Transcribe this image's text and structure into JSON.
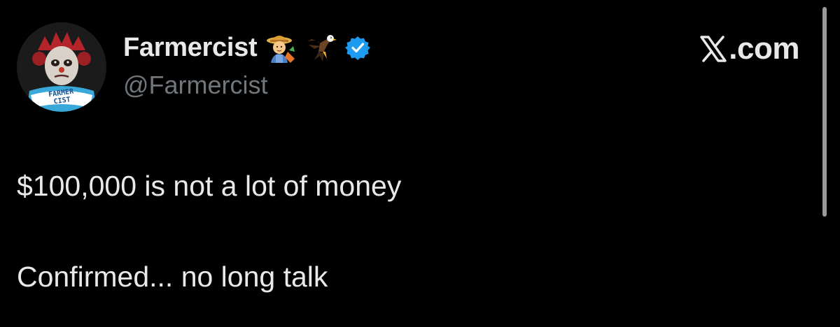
{
  "author": {
    "display_name": "Farmercist",
    "handle": "@Farmercist",
    "avatar_text_line1": "FARMER",
    "avatar_text_line2": "CIST",
    "name_emojis": [
      "farmer-emoji",
      "eagle-emoji"
    ],
    "verified": true,
    "verified_color": "#1d9bf0"
  },
  "brand": {
    "label": ".com",
    "icon": "x-logo-icon"
  },
  "tweet": {
    "line1": "$100,000 is not a lot of money",
    "line2": "Confirmed... no long talk"
  },
  "colors": {
    "background": "#000000",
    "primary_text": "#e7e9ea",
    "secondary_text": "#71767b",
    "accent": "#1d9bf0"
  }
}
